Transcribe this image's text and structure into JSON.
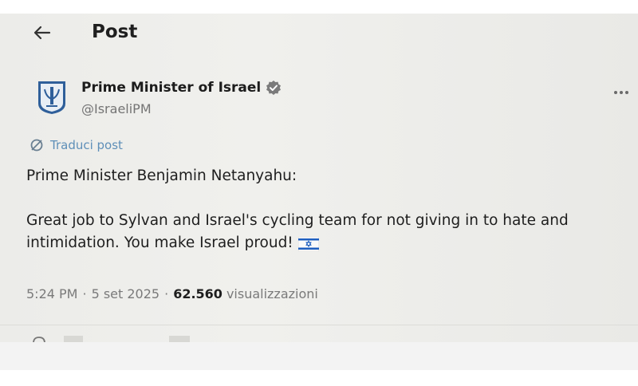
{
  "header": {
    "title": "Post"
  },
  "author": {
    "name": "Prime Minister of Israel",
    "handle": "@IsraeliPM"
  },
  "translate_label": "Traduci post",
  "post": {
    "text": "Prime Minister Benjamin Netanyahu:\n\nGreat job to Sylvan and Israel's cycling team for not giving in to hate and intimidation. You make Israel proud!"
  },
  "meta": {
    "time": "5:24 PM",
    "date": "5 set 2025",
    "views_count": "62.560",
    "views_label": "visualizzazioni",
    "separator": "·"
  },
  "colors": {
    "translate_link": "#5e8fb8",
    "verified_badge": "#7b7b7b",
    "flag_blue": "#1f5fbf"
  },
  "icons": [
    "back-arrow-icon",
    "emblem-avatar-icon",
    "verified-badge-icon",
    "more-options-icon",
    "translate-icon",
    "israel-flag-icon",
    "reply-icon"
  ]
}
